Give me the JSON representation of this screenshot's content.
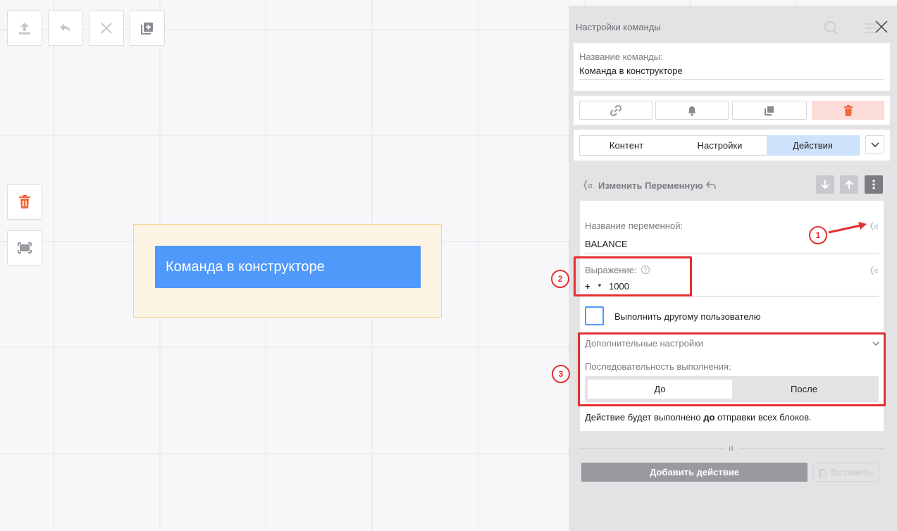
{
  "toolbar": {
    "upload_icon": "upload-icon",
    "undo_icon": "undo-icon",
    "close_icon": "close-icon",
    "add_copy_icon": "add-copy-icon"
  },
  "side_tools": {
    "delete_icon": "trash-icon",
    "frame_icon": "frame-icon"
  },
  "canvas": {
    "block_button_label": "Команда в конструкторе"
  },
  "panel": {
    "title": "Настройки команды",
    "command_name_label": "Название команды:",
    "command_name_value": "Команда в конструкторе",
    "actions": [
      "link-icon",
      "bell-icon",
      "copy-icon",
      "trash-icon"
    ],
    "tabs": [
      {
        "label": "Контент",
        "active": false
      },
      {
        "label": "Настройки",
        "active": false
      },
      {
        "label": "Действия",
        "active": true
      }
    ],
    "action_header": "Изменить Переменную",
    "variable_name_label": "Название переменной:",
    "variable_name_value": "BALANCE",
    "expression_label": "Выражение:",
    "expression_operator": "+",
    "expression_value": "1000",
    "other_user_label": "Выполнить другому пользователю",
    "extra_settings_label": "Дополнительные настройки",
    "sequence_label": "Последовательность выполнения:",
    "sequence_options": [
      {
        "label": "До",
        "selected": true
      },
      {
        "label": "После",
        "selected": false
      }
    ],
    "info_prefix": "Действие будет выполнено ",
    "info_bold": "до",
    "info_suffix": " отправки всех блоков.",
    "and_label": "и",
    "add_action_label": "Добавить действие",
    "paste_label": "Вставить"
  },
  "annotations": {
    "badge_1": "1",
    "badge_2": "2",
    "badge_3": "3"
  },
  "colors": {
    "accent_blue": "#4f99fb",
    "annotation_red": "#e33030",
    "active_tab": "#cfe2fb"
  }
}
